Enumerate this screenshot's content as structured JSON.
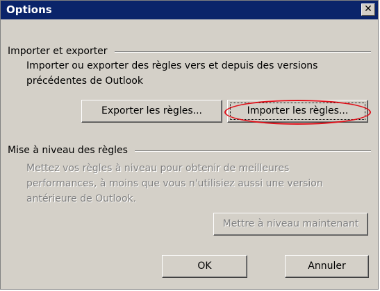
{
  "window": {
    "title": "Options",
    "close_glyph": "✕"
  },
  "import_export": {
    "heading": "Importer et exporter",
    "description_line1": "Importer ou exporter des règles vers et depuis des versions",
    "description_line2": "précédentes de Outlook",
    "export_label": "Exporter les règles...",
    "import_label": "Importer les règles..."
  },
  "upgrade": {
    "heading": "Mise à niveau des règles",
    "description_line1": "Mettez vos règles à niveau pour obtenir de meilleures",
    "description_line2": "performances, à moins que vous n'utilisiez aussi une version",
    "description_line3": "antérieure de Outlook.",
    "upgrade_label": "Mettre à niveau maintenant"
  },
  "footer": {
    "ok_label": "OK",
    "cancel_label": "Annuler"
  },
  "colors": {
    "titlebar": "#0a246a",
    "dialog_face": "#d4d0c8",
    "highlight_ring": "#e0101a",
    "disabled_text": "#808080"
  },
  "icons": {
    "close": "close-icon"
  }
}
